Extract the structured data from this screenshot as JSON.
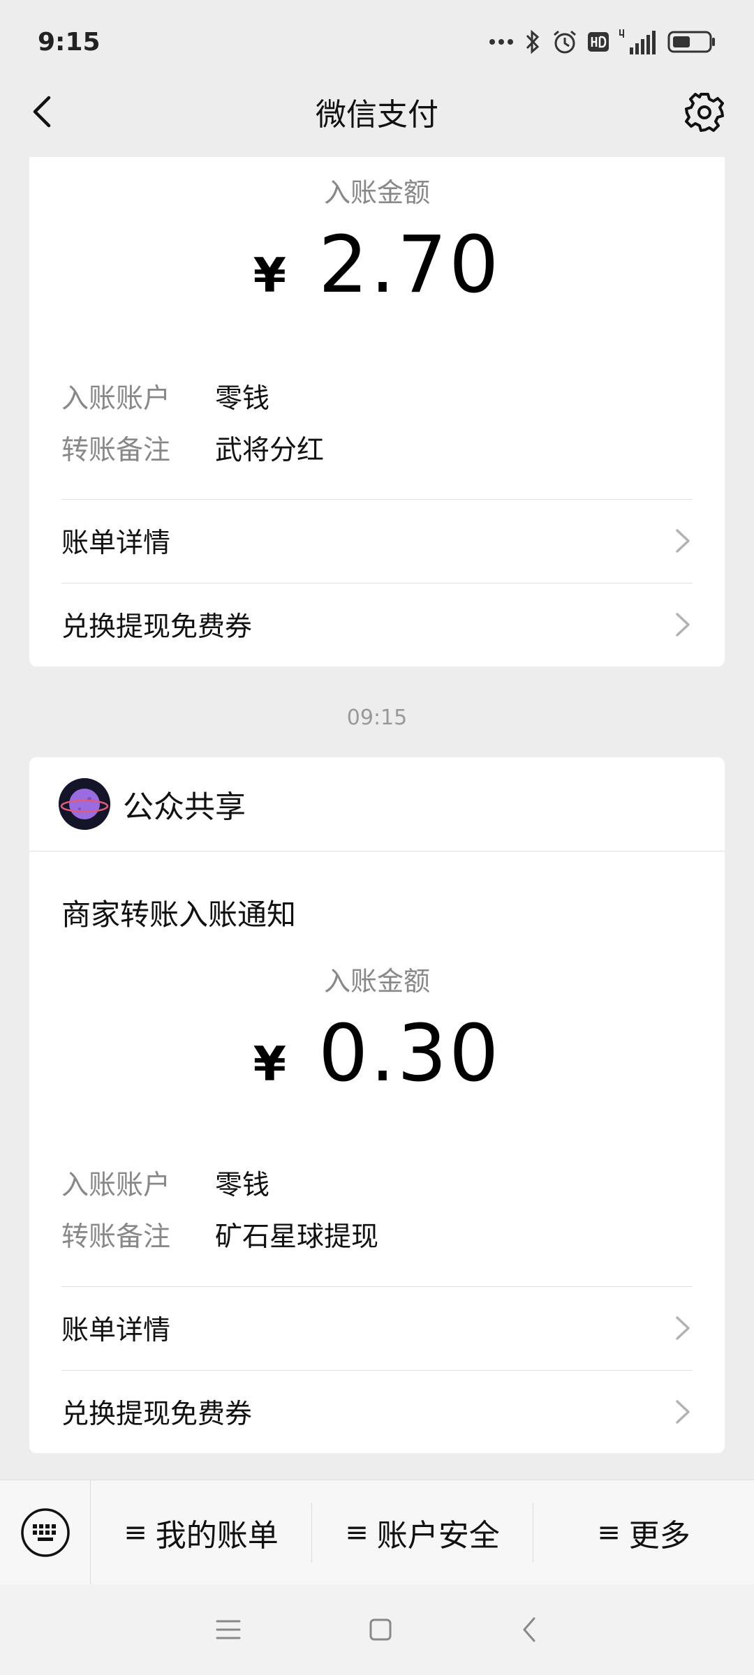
{
  "status_bar": {
    "time": "9:15"
  },
  "nav": {
    "title": "微信支付"
  },
  "card1": {
    "amount_label": "入账金额",
    "currency": "¥",
    "amount": "2.70",
    "account_key": "入账账户",
    "account_val": "零钱",
    "remark_key": "转账备注",
    "remark_val": "武将分红",
    "bill_detail": "账单详情",
    "coupon": "兑换提现免费券"
  },
  "timestamp": "09:15",
  "card2": {
    "publisher": "公众共享",
    "notice_title": "商家转账入账通知",
    "amount_label": "入账金额",
    "currency": "¥",
    "amount": "0.30",
    "account_key": "入账账户",
    "account_val": "零钱",
    "remark_key": "转账备注",
    "remark_val": "矿石星球提现",
    "bill_detail": "账单详情",
    "coupon": "兑换提现免费券"
  },
  "bottom_menu": {
    "glyph": "≡",
    "items": [
      "我的账单",
      "账户安全",
      "更多"
    ]
  },
  "colors": {
    "background": "#ededed",
    "card": "#ffffff",
    "muted_text": "#888888"
  }
}
